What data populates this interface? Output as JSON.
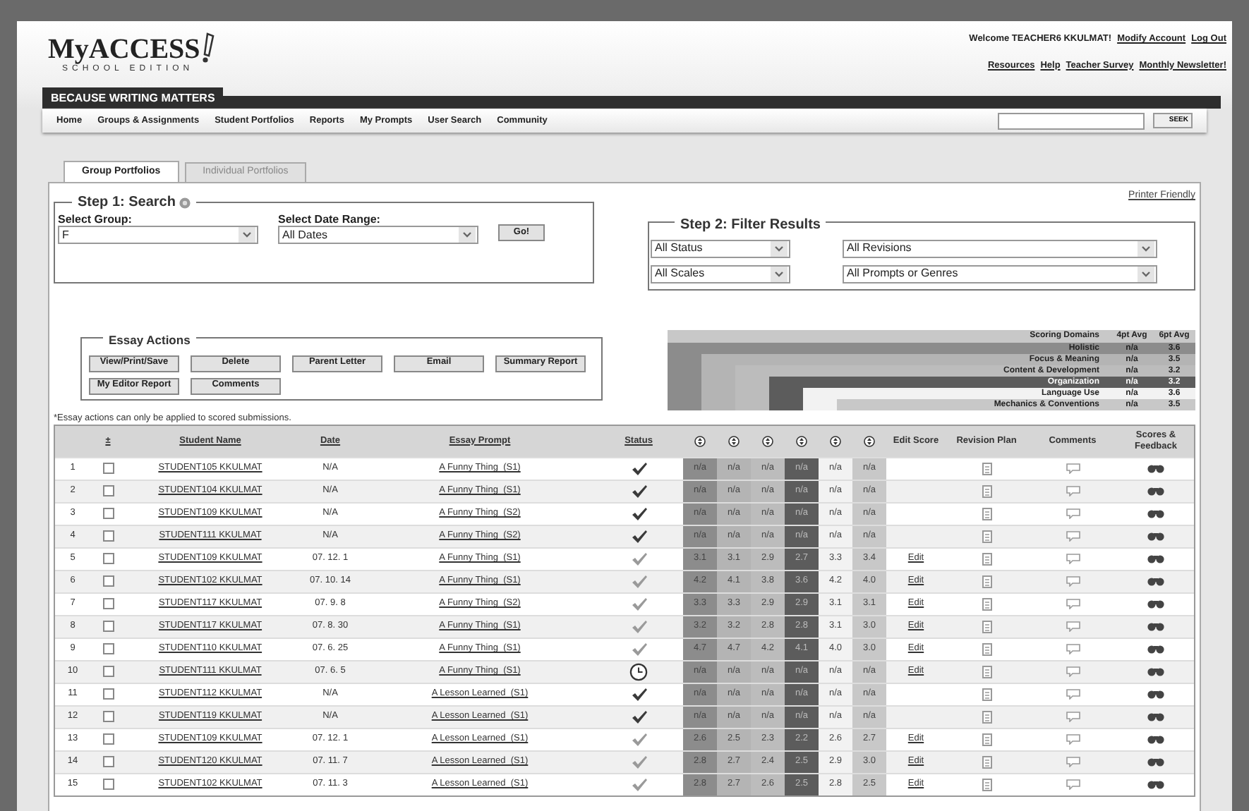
{
  "logo": {
    "name": "MyACCESS",
    "edition": "SCHOOL EDITION"
  },
  "account": {
    "welcome": "Welcome TEACHER6 KKULMAT!",
    "links": [
      "Modify Account",
      "Log Out"
    ],
    "links2": [
      "Resources",
      "Help",
      "Teacher Survey",
      "Monthly Newsletter!"
    ]
  },
  "tagline": "BECAUSE WRITING MATTERS",
  "nav": {
    "items": [
      "Home",
      "Groups & Assignments",
      "Student Portfolios",
      "Reports",
      "My Prompts",
      "User Search",
      "Community"
    ],
    "search_button": "SEEK"
  },
  "tabs": [
    {
      "label": "Group Portfolios",
      "selected": true
    },
    {
      "label": "Individual Portfolios",
      "selected": false
    }
  ],
  "printer_friendly": "Printer Friendly",
  "step1": {
    "legend": "Step 1: Search",
    "group_label": "Select Group:",
    "group": "F",
    "date_label": "Select Date Range:",
    "date": "All Dates",
    "go": "Go!"
  },
  "step2": {
    "legend": "Step 2: Filter Results",
    "status": "All Status",
    "revisions": "All Revisions",
    "scales": "All Scales",
    "prompts": "All Prompts or Genres"
  },
  "essay_actions": {
    "legend": "Essay Actions",
    "buttons": [
      "View/Print/Save",
      "Delete",
      "Parent Letter",
      "Email",
      "Summary Report",
      "My Editor Report",
      "Comments"
    ]
  },
  "note": "*Essay actions can only be applied to scored submissions.",
  "domains": {
    "columns": [
      "Scoring Domains",
      "4pt Avg",
      "6pt Avg"
    ],
    "rows": [
      {
        "name": "Holistic",
        "avg4": "n/a",
        "avg6": "3.6",
        "color": "#8c8c8c"
      },
      {
        "name": "Focus & Meaning",
        "avg4": "n/a",
        "avg6": "3.5",
        "color": "#b4b4b4"
      },
      {
        "name": "Content & Development",
        "avg4": "n/a",
        "avg6": "3.2",
        "color": "#bcbcbc"
      },
      {
        "name": "Organization",
        "avg4": "n/a",
        "avg6": "3.2",
        "color": "#5c5c5c"
      },
      {
        "name": "Language Use",
        "avg4": "n/a",
        "avg6": "3.6",
        "color": "#f2f2f2"
      },
      {
        "name": "Mechanics & Conventions",
        "avg4": "n/a",
        "avg6": "3.5",
        "color": "#c8c8c8"
      }
    ]
  },
  "table": {
    "columns": [
      "±",
      "Student Name",
      "Date",
      "Essay Prompt",
      "Status",
      "Edit Score",
      "Revision Plan",
      "Comments",
      "Scores & Feedback"
    ],
    "rows": [
      {
        "num": "1",
        "checked": false,
        "name": "STUDENT105 KKULMAT",
        "date": "N/A",
        "prompt": "A Funny Thing  (S1)",
        "status": {
          "kind": "check"
        },
        "scores": [
          "n/a",
          "n/a",
          "n/a",
          "n/a",
          "n/a",
          "n/a"
        ]
      },
      {
        "num": "2",
        "checked": false,
        "name": "STUDENT104 KKULMAT",
        "date": "N/A",
        "prompt": "A Funny Thing  (S1)",
        "status": {
          "kind": "check"
        },
        "scores": [
          "n/a",
          "n/a",
          "n/a",
          "n/a",
          "n/a",
          "n/a"
        ]
      },
      {
        "num": "3",
        "checked": false,
        "name": "STUDENT109 KKULMAT",
        "date": "N/A",
        "prompt": "A Funny Thing  (S2)",
        "status": {
          "kind": "check"
        },
        "scores": [
          "n/a",
          "n/a",
          "n/a",
          "n/a",
          "n/a",
          "n/a"
        ]
      },
      {
        "num": "4",
        "checked": false,
        "name": "STUDENT111 KKULMAT",
        "date": "N/A",
        "prompt": "A Funny Thing  (S2)",
        "status": {
          "kind": "check"
        },
        "scores": [
          "n/a",
          "n/a",
          "n/a",
          "n/a",
          "n/a",
          "n/a"
        ]
      },
      {
        "num": "5",
        "checked": false,
        "name": "STUDENT109 KKULMAT",
        "date": "07. 12. 1",
        "prompt": "A Funny Thing  (S1)",
        "status": {
          "kind": "pale"
        },
        "scores": [
          "3.1",
          "3.1",
          "2.9",
          "2.7",
          "3.3",
          "3.4"
        ],
        "edit": "Edit"
      },
      {
        "num": "6",
        "checked": false,
        "name": "STUDENT102 KKULMAT",
        "date": "07. 10. 14",
        "prompt": "A Funny Thing  (S1)",
        "status": {
          "kind": "pale"
        },
        "scores": [
          "4.2",
          "4.1",
          "3.8",
          "3.6",
          "4.2",
          "4.0"
        ],
        "edit": "Edit"
      },
      {
        "num": "7",
        "checked": false,
        "name": "STUDENT117 KKULMAT",
        "date": "07. 9. 8",
        "prompt": "A Funny Thing  (S2)",
        "status": {
          "kind": "pale"
        },
        "scores": [
          "3.3",
          "3.3",
          "2.9",
          "2.9",
          "3.1",
          "3.1"
        ],
        "edit": "Edit"
      },
      {
        "num": "8",
        "checked": false,
        "name": "STUDENT117 KKULMAT",
        "date": "07. 8. 30",
        "prompt": "A Funny Thing  (S1)",
        "status": {
          "kind": "pale"
        },
        "scores": [
          "3.2",
          "3.2",
          "2.8",
          "2.8",
          "3.1",
          "3.0"
        ],
        "edit": "Edit"
      },
      {
        "num": "9",
        "checked": false,
        "name": "STUDENT110 KKULMAT",
        "date": "07. 6. 25",
        "prompt": "A Funny Thing  (S1)",
        "status": {
          "kind": "pale"
        },
        "scores": [
          "4.7",
          "4.7",
          "4.2",
          "4.1",
          "4.0",
          "3.0"
        ],
        "edit": "Edit"
      },
      {
        "num": "10",
        "checked": false,
        "name": "STUDENT111 KKULMAT",
        "date": "07. 6. 5",
        "prompt": "A Funny Thing  (S1)",
        "status": {
          "kind": "clock"
        },
        "scores": [
          "n/a",
          "n/a",
          "n/a",
          "n/a",
          "n/a",
          "n/a"
        ],
        "edit": "Edit"
      },
      {
        "num": "11",
        "checked": false,
        "name": "STUDENT112 KKULMAT",
        "date": "N/A",
        "prompt": "A Lesson Learned  (S1)",
        "status": {
          "kind": "check"
        },
        "scores": [
          "n/a",
          "n/a",
          "n/a",
          "n/a",
          "n/a",
          "n/a"
        ]
      },
      {
        "num": "12",
        "checked": false,
        "name": "STUDENT119 KKULMAT",
        "date": "N/A",
        "prompt": "A Lesson Learned  (S1)",
        "status": {
          "kind": "check"
        },
        "scores": [
          "n/a",
          "n/a",
          "n/a",
          "n/a",
          "n/a",
          "n/a"
        ]
      },
      {
        "num": "13",
        "checked": false,
        "name": "STUDENT109 KKULMAT",
        "date": "07. 12. 1",
        "prompt": "A Lesson Learned  (S1)",
        "status": {
          "kind": "pale"
        },
        "scores": [
          "2.6",
          "2.5",
          "2.3",
          "2.2",
          "2.6",
          "2.7"
        ],
        "edit": "Edit"
      },
      {
        "num": "14",
        "checked": false,
        "name": "STUDENT120 KKULMAT",
        "date": "07. 11. 7",
        "prompt": "A Lesson Learned  (S1)",
        "status": {
          "kind": "pale"
        },
        "scores": [
          "2.8",
          "2.7",
          "2.4",
          "2.5",
          "2.9",
          "3.0"
        ],
        "edit": "Edit"
      },
      {
        "num": "15",
        "checked": false,
        "name": "STUDENT102 KKULMAT",
        "date": "07. 11. 3",
        "prompt": "A Lesson Learned  (S1)",
        "status": {
          "kind": "pale"
        },
        "scores": [
          "2.8",
          "2.7",
          "2.6",
          "2.5",
          "2.8",
          "2.5"
        ],
        "edit": "Edit"
      }
    ]
  }
}
